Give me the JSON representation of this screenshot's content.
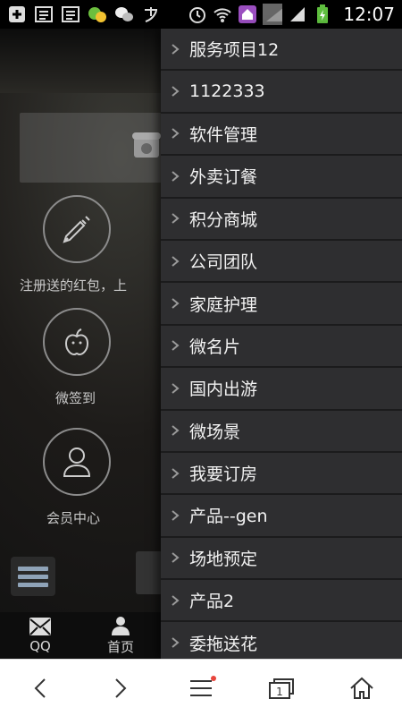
{
  "status_bar": {
    "time": "12:07",
    "icons_left": [
      "add-box-icon",
      "document-icon",
      "document-icon",
      "chat-app-icon",
      "wechat-icon",
      "alipay-icon"
    ],
    "icons_right": [
      "alarm-icon",
      "wifi-icon",
      "home-icon",
      "signal-icon",
      "signal-icon",
      "battery-charging-icon"
    ]
  },
  "background": {
    "items": [
      {
        "label": "注册送的红包，上",
        "icon": "syringe-icon"
      },
      {
        "label": "微签到",
        "icon": "apple-icon"
      },
      {
        "label": "会员中心",
        "icon": "user-icon"
      }
    ],
    "bottom_tabs": [
      {
        "label": "QQ",
        "icon": "envelope-icon"
      },
      {
        "label": "首页",
        "icon": "person-icon"
      }
    ]
  },
  "drawer": {
    "items": [
      "服务项目12",
      "1122333",
      "软件管理",
      "外卖订餐",
      "积分商城",
      "公司团队",
      "家庭护理",
      "微名片",
      "国内出游",
      "微场景",
      "我要订房",
      "产品--gen",
      "场地预定",
      "产品2",
      "委拖送花"
    ]
  },
  "browser_bar": {
    "buttons": [
      "back",
      "forward",
      "menu",
      "tabs",
      "home"
    ],
    "tab_count": "1",
    "accent": "#e8453c"
  }
}
